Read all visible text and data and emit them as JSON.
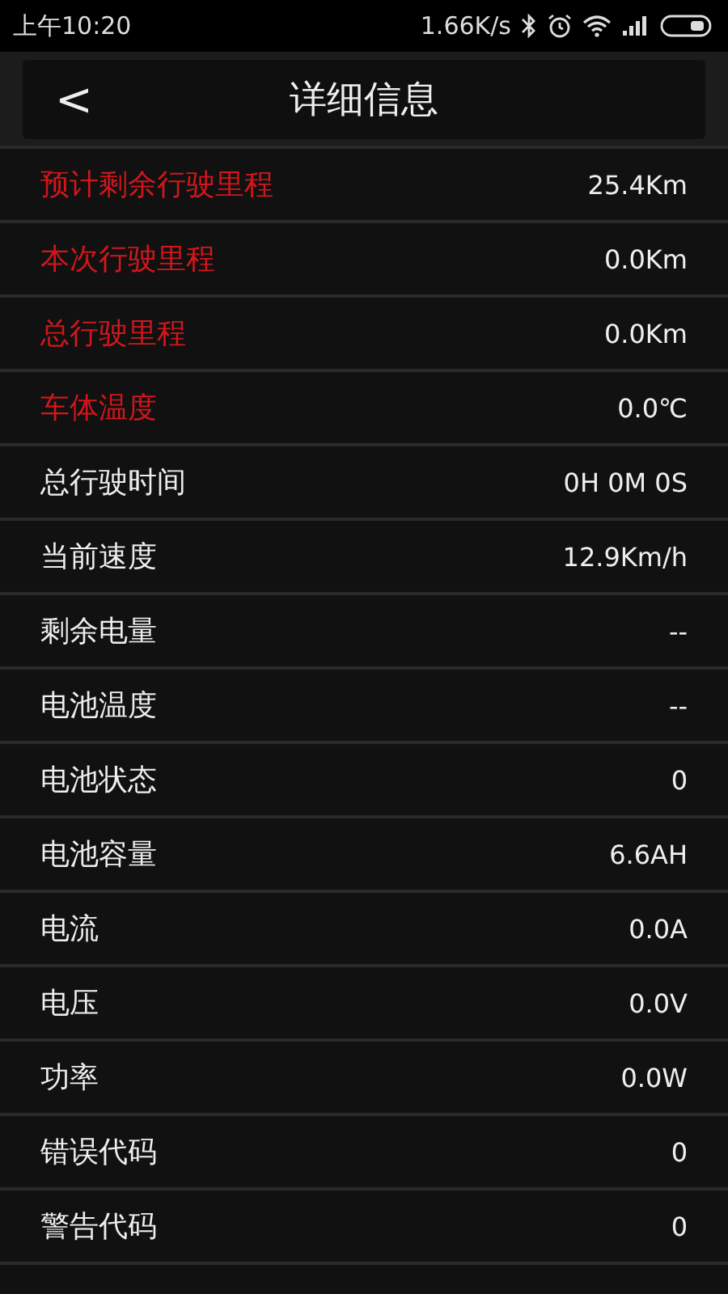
{
  "status_bar": {
    "time": "上午10:20",
    "speed": "1.66K/s"
  },
  "header": {
    "back": "<",
    "title": "详细信息"
  },
  "rows": [
    {
      "label": "预计剩余行驶里程",
      "value": "25.4Km",
      "highlighted": true
    },
    {
      "label": "本次行驶里程",
      "value": "0.0Km",
      "highlighted": true
    },
    {
      "label": "总行驶里程",
      "value": "0.0Km",
      "highlighted": true
    },
    {
      "label": "车体温度",
      "value": "0.0℃",
      "highlighted": true
    },
    {
      "label": "总行驶时间",
      "value": "0H 0M 0S",
      "highlighted": false
    },
    {
      "label": "当前速度",
      "value": "12.9Km/h",
      "highlighted": false
    },
    {
      "label": "剩余电量",
      "value": "--",
      "highlighted": false
    },
    {
      "label": "电池温度",
      "value": "--",
      "highlighted": false
    },
    {
      "label": "电池状态",
      "value": "0",
      "highlighted": false
    },
    {
      "label": "电池容量",
      "value": "6.6AH",
      "highlighted": false
    },
    {
      "label": "电流",
      "value": "0.0A",
      "highlighted": false
    },
    {
      "label": "电压",
      "value": "0.0V",
      "highlighted": false
    },
    {
      "label": "功率",
      "value": "0.0W",
      "highlighted": false
    },
    {
      "label": "错误代码",
      "value": "0",
      "highlighted": false
    },
    {
      "label": "警告代码",
      "value": "0",
      "highlighted": false
    }
  ]
}
